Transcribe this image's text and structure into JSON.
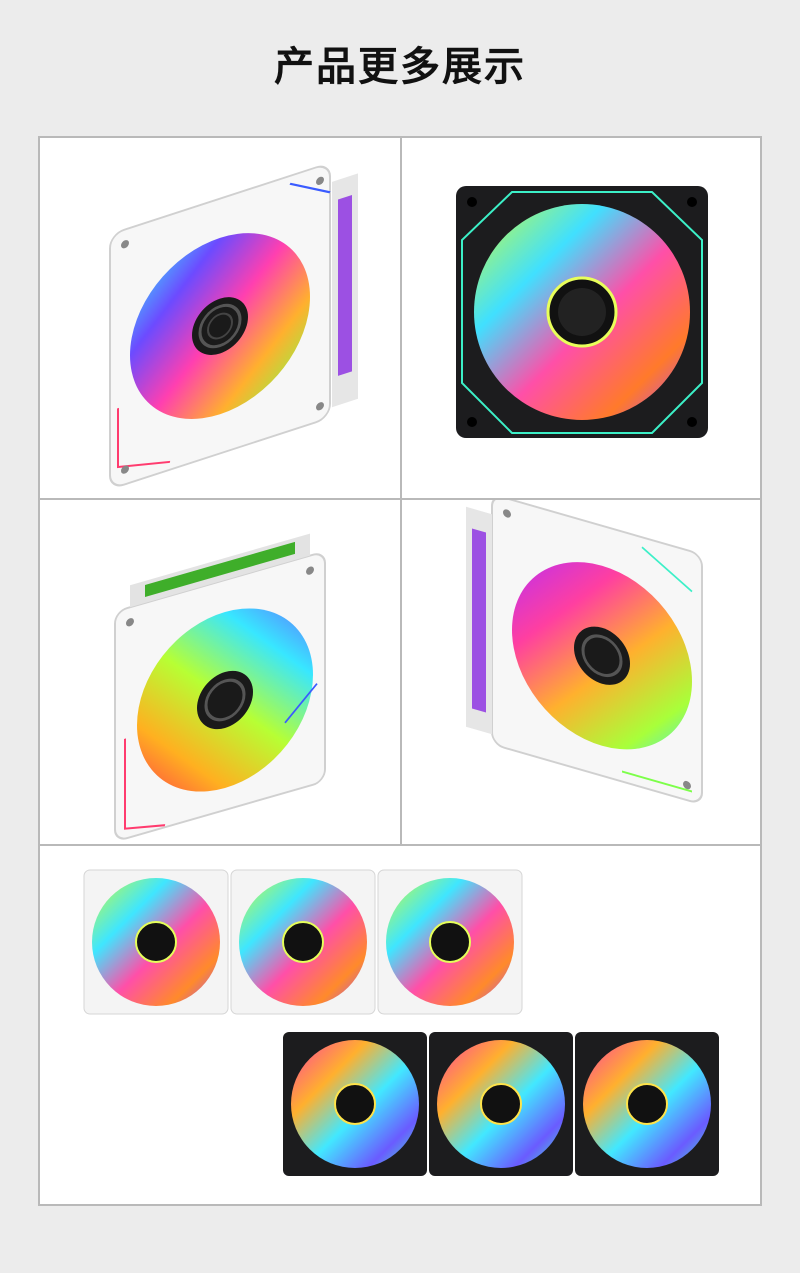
{
  "title": "产品更多展示",
  "panels": [
    {
      "name": "white-fan-angled-right",
      "variant": "white"
    },
    {
      "name": "black-fan-front",
      "variant": "black"
    },
    {
      "name": "white-fan-angled-top",
      "variant": "white"
    },
    {
      "name": "white-fan-angled-left",
      "variant": "white"
    },
    {
      "name": "fan-rows",
      "variant": "white+black"
    }
  ],
  "colors": {
    "white_frame": "#f6f6f6",
    "black_frame": "#1c1c1e",
    "divider": "#b9b9b9"
  }
}
